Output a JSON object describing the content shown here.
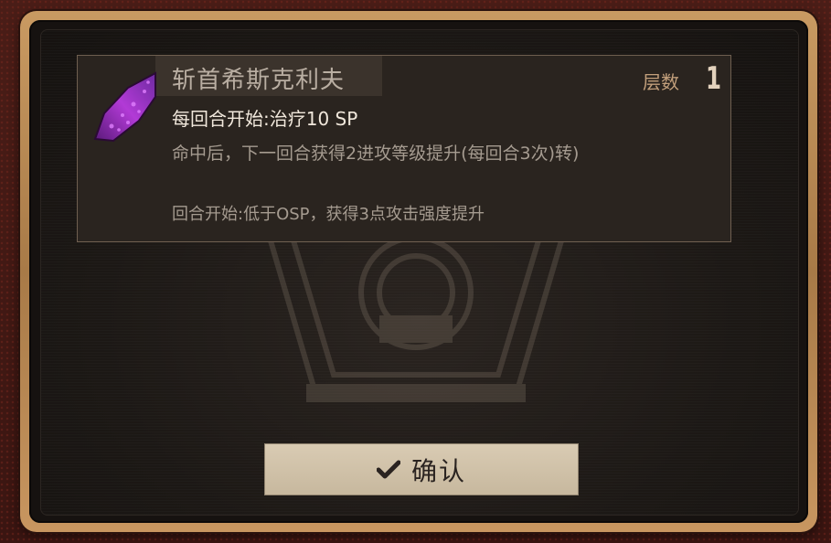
{
  "card": {
    "title": "斩首希斯克利夫",
    "layers_label": "层数",
    "layers_value": "1",
    "line1": "每回合开始:治疗10 SP",
    "line2": "命中后，下一回合获得2进攻等级提升(每回合3次)转)",
    "line3": "回合开始:低于OSP，获得3点攻击强度提升",
    "icon": "purple-crystal-shard-icon"
  },
  "confirm": {
    "label": "确认",
    "icon": "checkmark-icon"
  },
  "colors": {
    "frame_gold": "#c99a62",
    "panel_dark": "#1c1815",
    "button_bg": "#d9cbb3"
  }
}
